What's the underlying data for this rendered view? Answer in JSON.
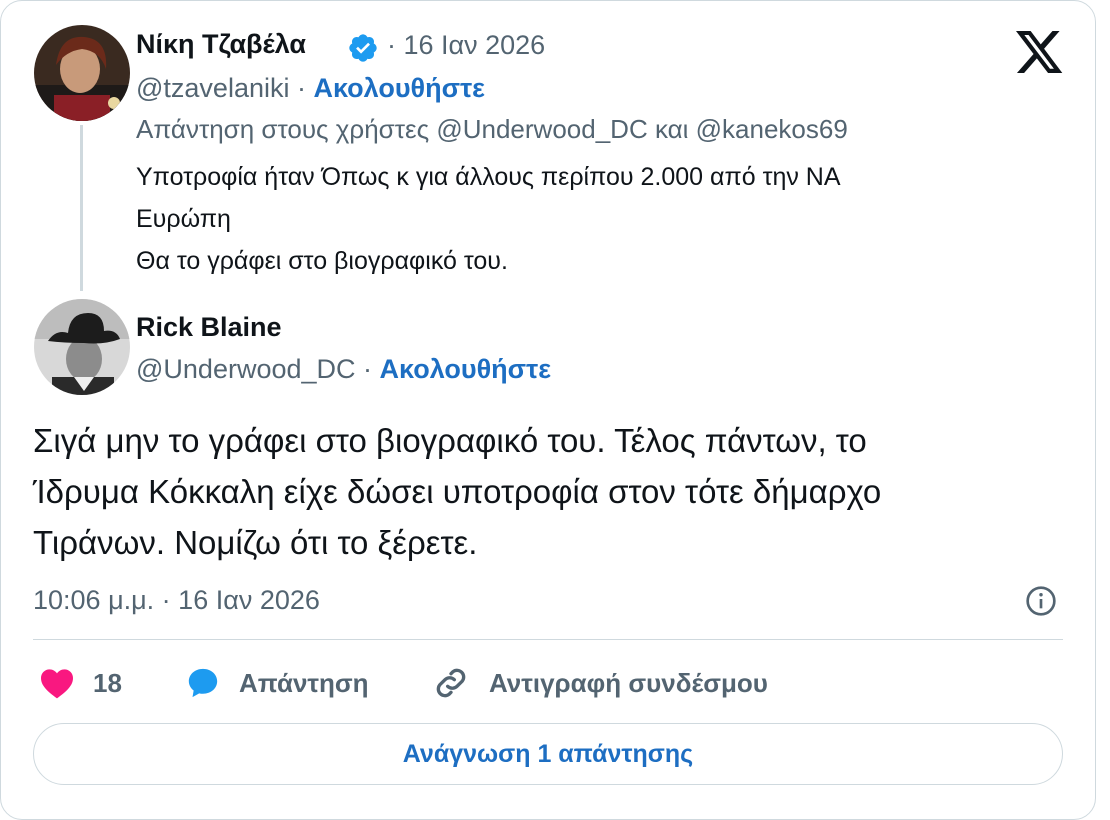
{
  "quoted_tweet": {
    "author_name": "Νίκη Τζαβέλα",
    "dot_date": "· 16 Ιαν 2026",
    "handle": "@tzavelaniki",
    "separator": "·",
    "follow_label": "Ακολουθήστε",
    "reply_to": "Απάντηση στους χρήστες @Underwood_DC και @kanekos69",
    "text_lines": [
      "Υποτροφία ήταν Όπως κ για άλλους περίπου 2.000 από την ΝΑ",
      "Ευρώπη",
      "Θα το γράφει στο βιογραφικό του."
    ]
  },
  "main_tweet": {
    "author_name": "Rick Blaine",
    "handle": "@Underwood_DC",
    "separator": "·",
    "follow_label": "Ακολουθήστε",
    "text_lines": [
      "Σιγά μην το γράφει στο βιογραφικό του. Τέλος πάντων, το",
      "Ίδρυμα Κόκκαλη είχε δώσει υποτροφία στον τότε δήμαρχο",
      "Τιράνων. Νομίζω ότι το ξέρετε."
    ],
    "timestamp": "10:06 μ.μ. · 16 Ιαν 2026"
  },
  "actions": {
    "like_count": "18",
    "reply_label": "Απάντηση",
    "copy_link_label": "Αντιγραφή συνδέσμου"
  },
  "read_replies_label": "Ανάγνωση 1 απάντησης",
  "icons": [
    "verified-badge-icon",
    "x-logo-icon",
    "info-icon",
    "heart-icon",
    "reply-bubble-icon",
    "link-icon"
  ],
  "colors": {
    "accent": "#1d6ec2",
    "verified": "#1d9bf0",
    "like": "#f91880",
    "muted": "#536471",
    "border": "#cfd9de"
  }
}
